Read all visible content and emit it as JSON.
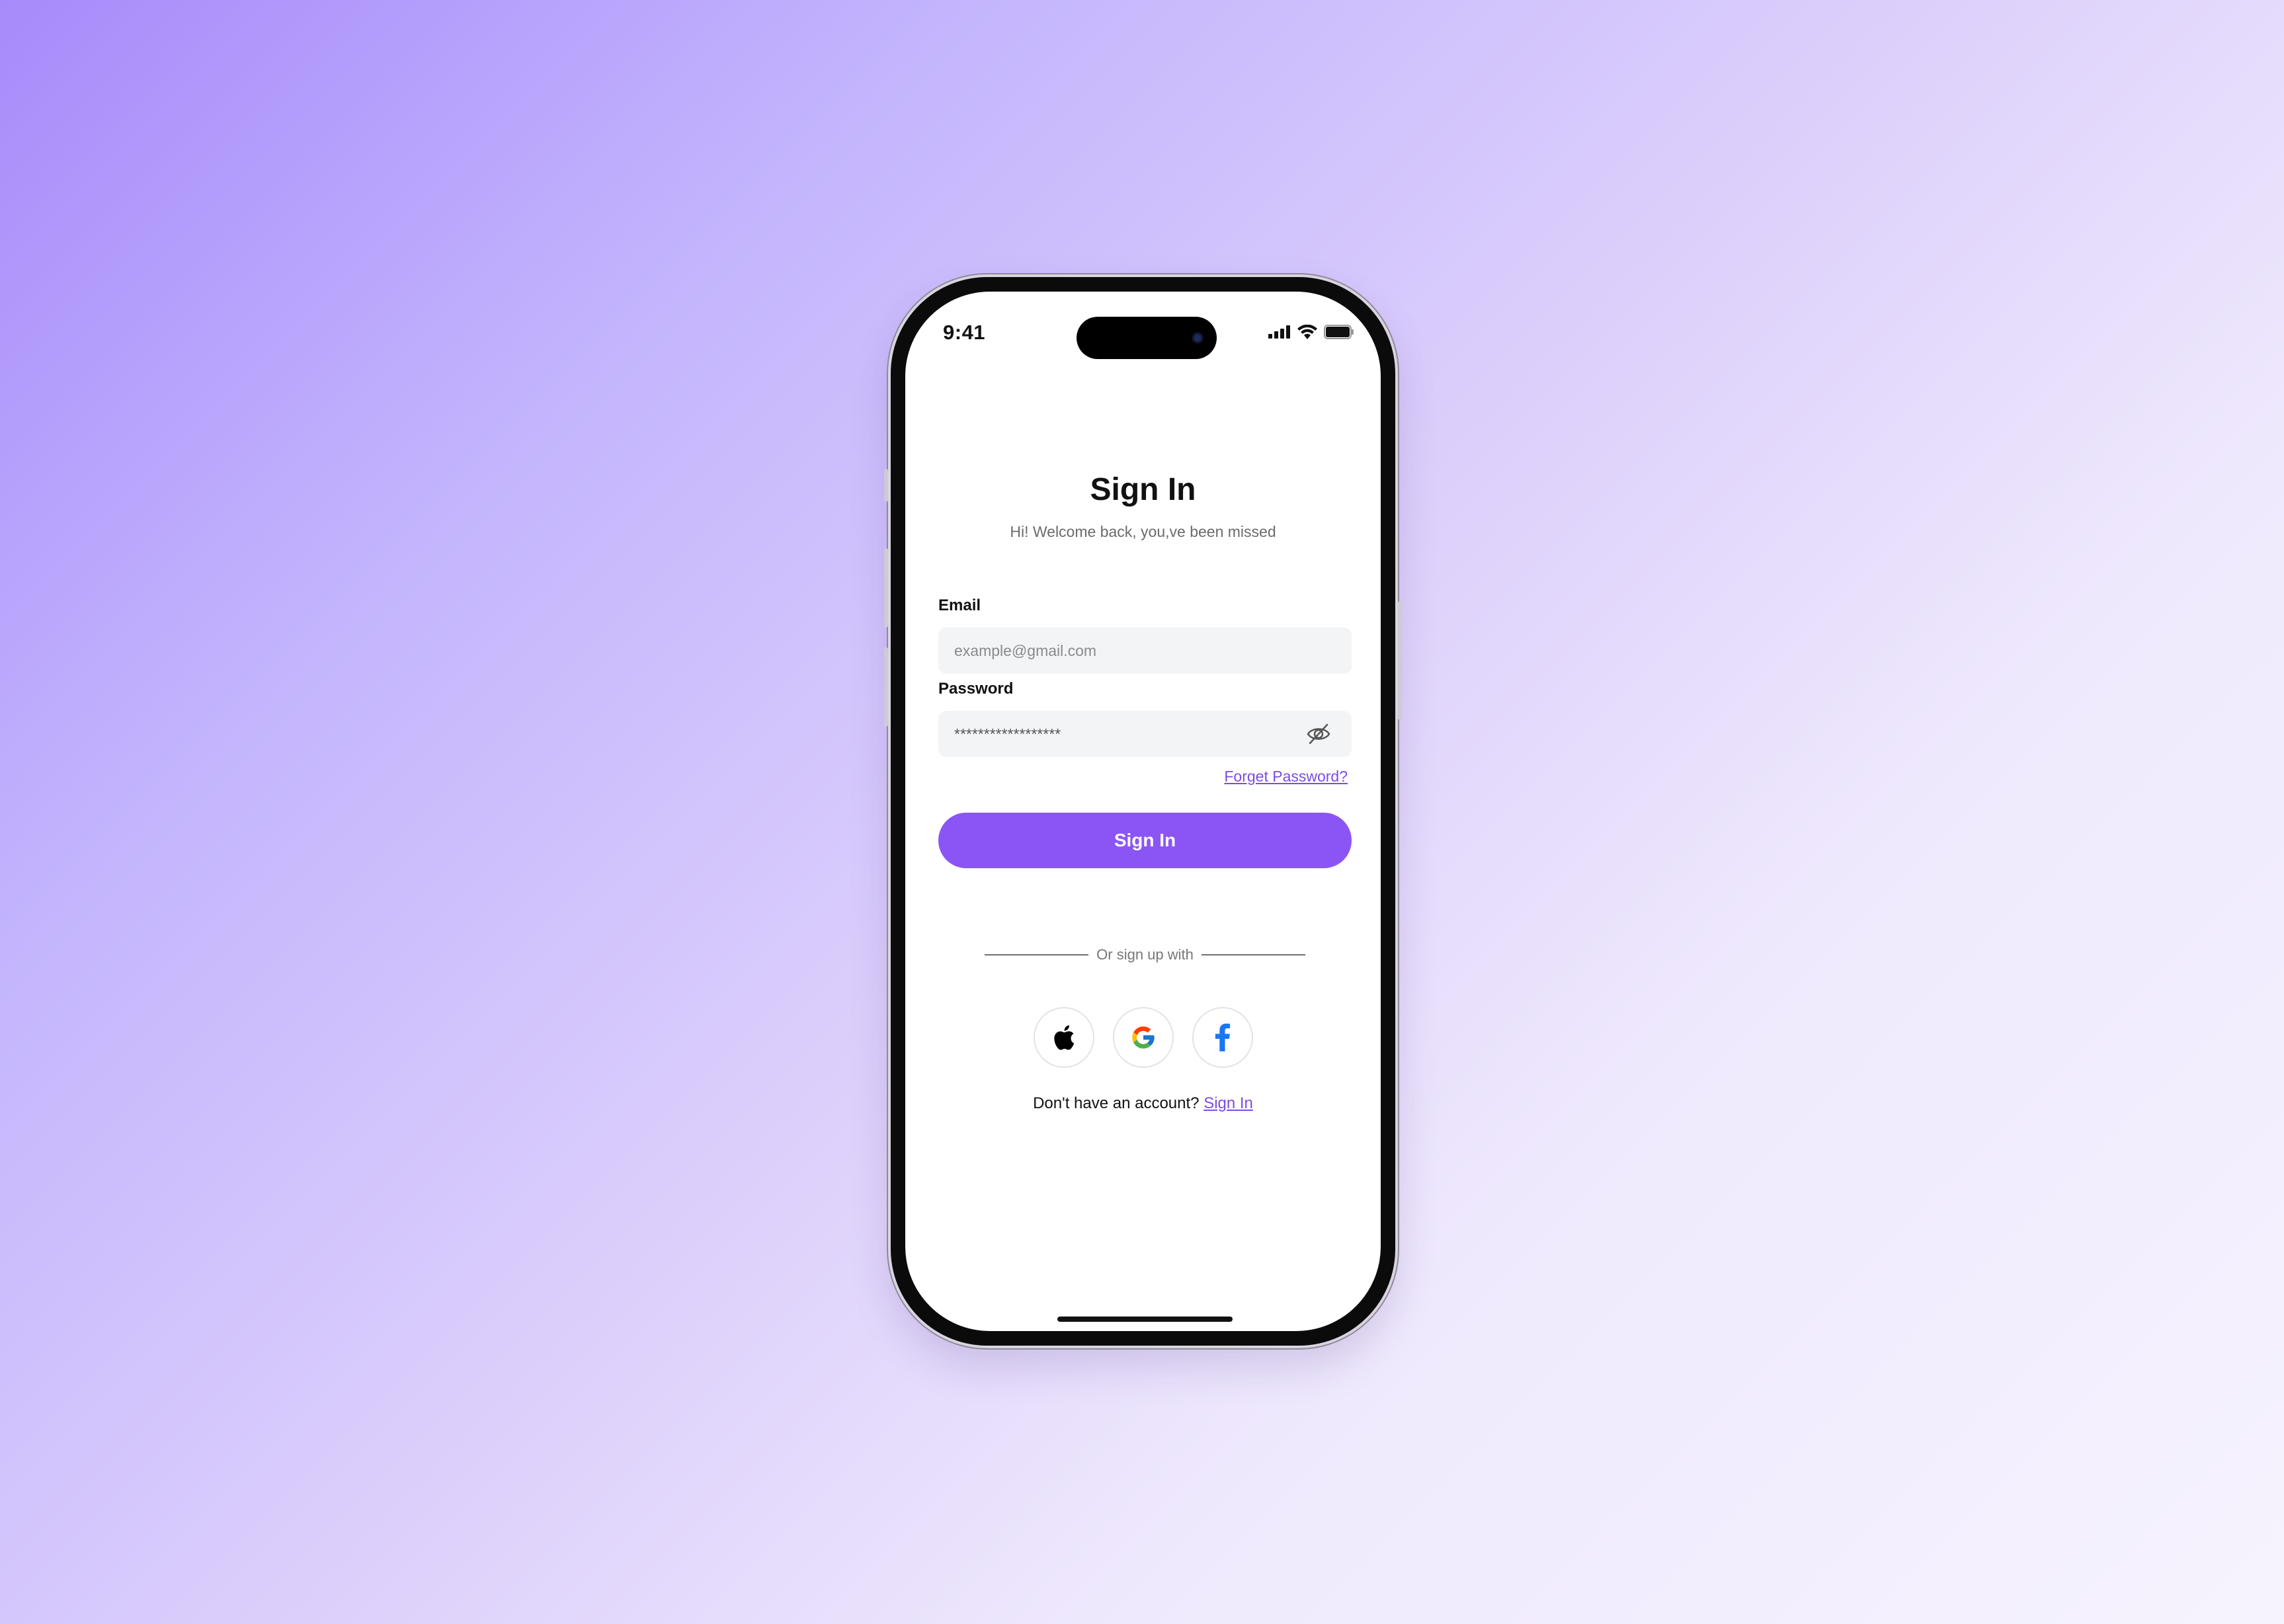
{
  "status_bar": {
    "time": "9:41"
  },
  "screen": {
    "title": "Sign In",
    "subtitle": "Hi! Welcome back, you,ve been missed"
  },
  "form": {
    "email_label": "Email",
    "email_placeholder": "example@gmail.com",
    "password_label": "Password",
    "password_value": "******************",
    "forgot_label": "Forget Password?",
    "submit_label": "Sign In"
  },
  "divider_text": "Or sign up with",
  "social_buttons": [
    {
      "icon": "apple-icon"
    },
    {
      "icon": "google-icon"
    },
    {
      "icon": "facebook-icon"
    }
  ],
  "footer": {
    "prompt": "Don't have an account?",
    "link_label": "Sign In"
  },
  "colors": {
    "accent": "#8b55f5",
    "link": "#7c4ddf",
    "background_start": "#a78bfa",
    "background_end": "#f6f3fe"
  }
}
